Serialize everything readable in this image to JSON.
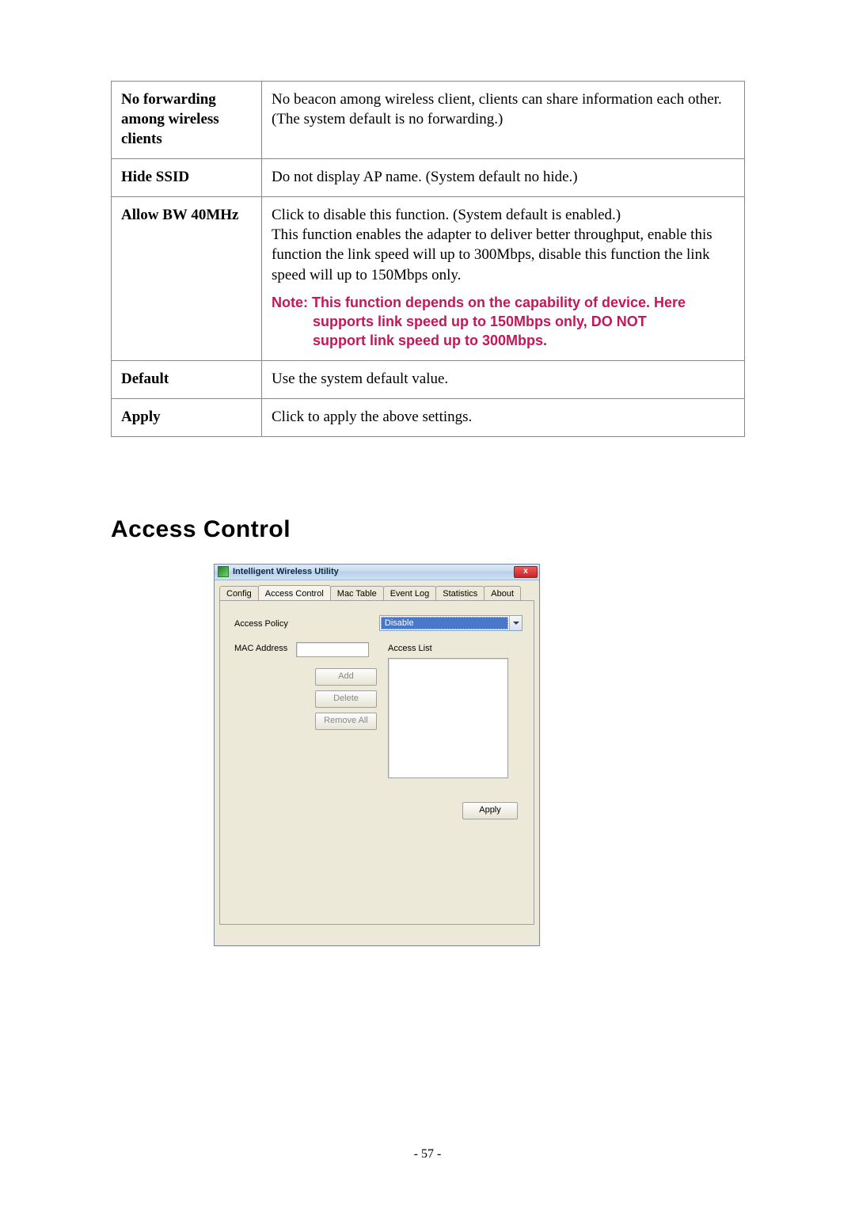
{
  "table": {
    "rows": [
      {
        "label": "No forwarding among wireless clients",
        "desc": "No beacon among wireless client, clients can share information each other. (The system default is no forwarding.)"
      },
      {
        "label": "Hide SSID",
        "desc": "Do not display AP name. (System default no hide.)"
      },
      {
        "label": "Allow BW 40MHz",
        "desc": "Click to disable this function. (System default is enabled.)\nThis function enables the adapter to deliver better throughput, enable this function the link speed will up to 300Mbps, disable this function the link speed will up to 150Mbps only.",
        "note_lead": "Note: This function depends on the capability of device. Here",
        "note_line2": "supports link speed up to 150Mbps only, DO NOT",
        "note_line3": "support link speed up to 300Mbps."
      },
      {
        "label": "Default",
        "desc": "Use the system default value."
      },
      {
        "label": "Apply",
        "desc": "Click to apply the above settings."
      }
    ]
  },
  "section_heading": "Access Control",
  "window": {
    "title": "Intelligent Wireless Utility",
    "close_glyph": "x",
    "tabs": [
      "Config",
      "Access Control",
      "Mac Table",
      "Event Log",
      "Statistics",
      "About"
    ],
    "active_tab_index": 1,
    "labels": {
      "access_policy": "Access Policy",
      "mac_address": "MAC Address",
      "access_list": "Access List"
    },
    "policy_value": "Disable",
    "mac_value": "",
    "buttons": {
      "add": "Add",
      "delete": "Delete",
      "remove_all": "Remove All",
      "apply": "Apply"
    }
  },
  "page_number": "- 57 -"
}
